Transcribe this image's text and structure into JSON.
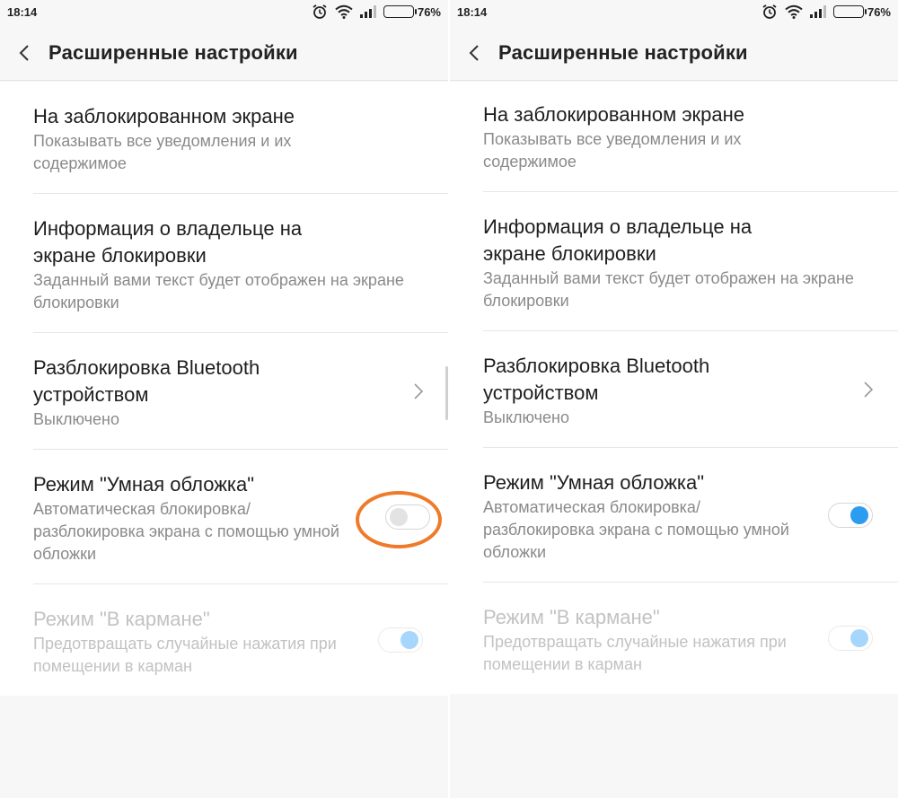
{
  "left": {
    "status": {
      "time": "18:14",
      "battery": "76%",
      "battery_level": 0.76
    },
    "header": {
      "title": "Расширенные настройки"
    },
    "items": [
      {
        "title": "На заблокированном экране",
        "subtitle": "Показывать все уведомления и их содержимое"
      },
      {
        "title": "Информация о владельце на экране блокировки",
        "subtitle": "Заданный вами текст будет отображен на экране блокировки"
      },
      {
        "title": "Разблокировка Bluetooth устройством",
        "subtitle": "Выключено"
      },
      {
        "title": "Режим \"Умная обложка\"",
        "subtitle": "Автоматическая блокировка/ разблокировка экрана с помощью умной обложки",
        "toggle": "off"
      },
      {
        "title": "Режим \"В кармане\"",
        "subtitle": "Предотвращать случайные нажатия при помещении в карман",
        "toggle": "on-disabled"
      }
    ]
  },
  "right": {
    "status": {
      "time": "18:14",
      "battery": "76%",
      "battery_level": 0.76
    },
    "header": {
      "title": "Расширенные настройки"
    },
    "items": [
      {
        "title": "На заблокированном экране",
        "subtitle": "Показывать все уведомления и их содержимое"
      },
      {
        "title": "Информация о владельце на экране блокировки",
        "subtitle": "Заданный вами текст будет отображен на экране блокировки"
      },
      {
        "title": "Разблокировка Bluetooth устройством",
        "subtitle": "Выключено"
      },
      {
        "title": "Режим \"Умная обложка\"",
        "subtitle": "Автоматическая блокировка/ разблокировка экрана с помощью умной обложки",
        "toggle": "on"
      },
      {
        "title": "Режим \"В кармане\"",
        "subtitle": "Предотвращать случайные нажатия при помещении в карман",
        "toggle": "on-disabled"
      }
    ]
  },
  "colors": {
    "accent": "#2b9cf0",
    "highlight": "#ef7a2a",
    "background": "#f7f7f7"
  },
  "icons": {
    "back": "chevron-left-icon",
    "chevron": "chevron-right-icon",
    "alarm": "alarm-icon",
    "wifi": "wifi-icon",
    "signal": "signal-icon",
    "battery": "battery-icon"
  }
}
